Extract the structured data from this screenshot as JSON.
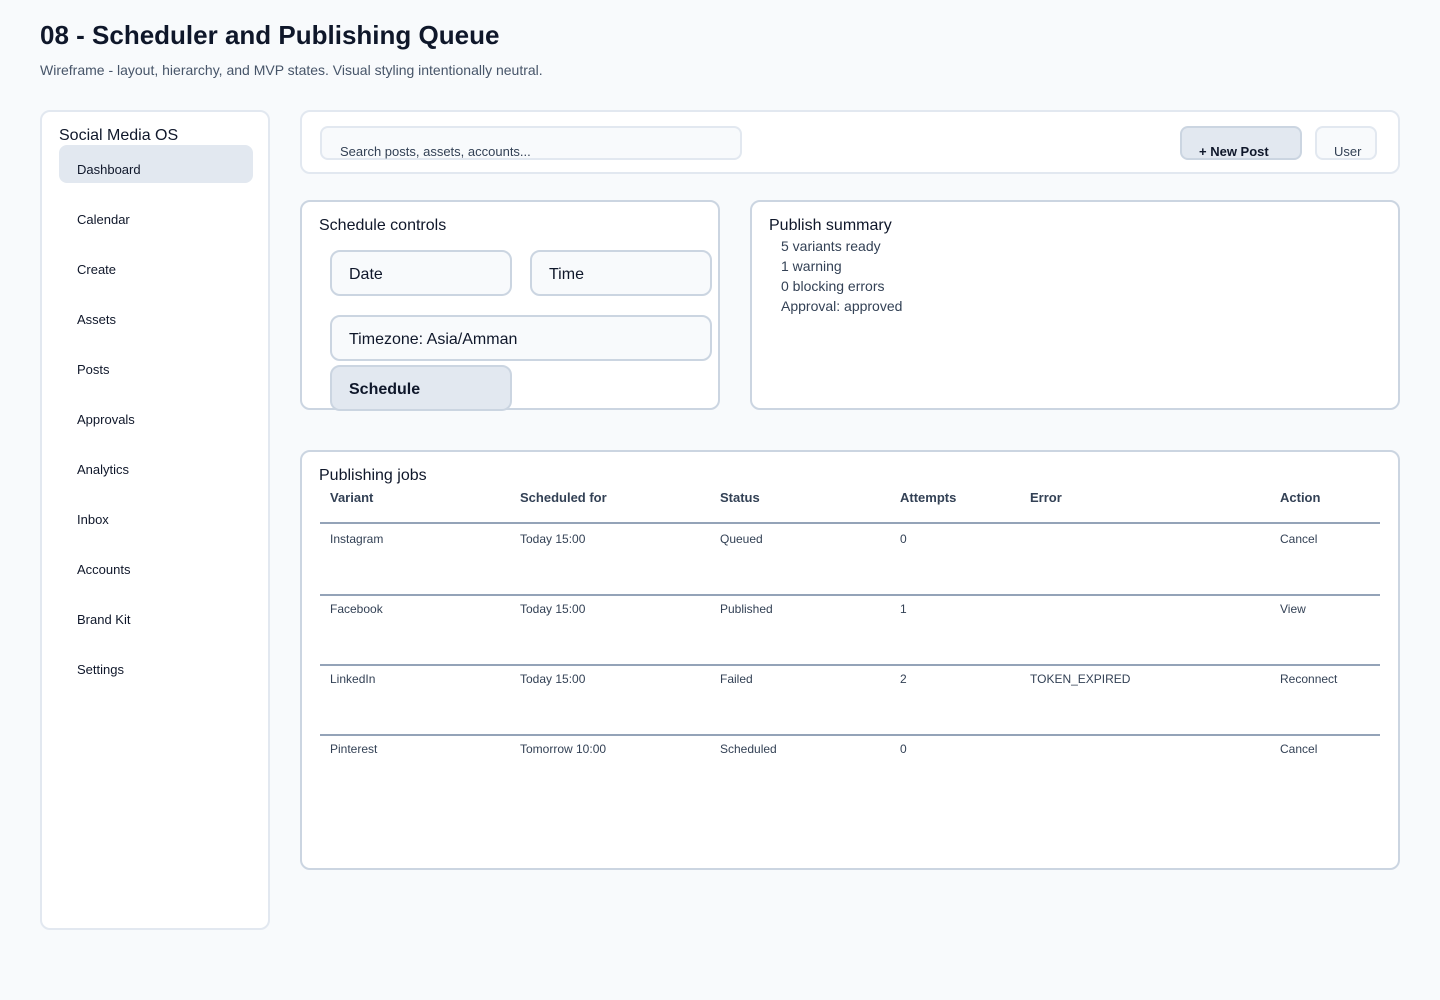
{
  "page": {
    "title": "08 - Scheduler and Publishing Queue",
    "subtitle": "Wireframe - layout, hierarchy, and MVP states. Visual styling intentionally neutral."
  },
  "sidebar": {
    "brand": "Social Media OS",
    "items": [
      {
        "label": "Dashboard",
        "active": true
      },
      {
        "label": "Calendar"
      },
      {
        "label": "Create"
      },
      {
        "label": "Assets"
      },
      {
        "label": "Posts"
      },
      {
        "label": "Approvals"
      },
      {
        "label": "Analytics"
      },
      {
        "label": "Inbox"
      },
      {
        "label": "Accounts"
      },
      {
        "label": "Brand Kit"
      },
      {
        "label": "Settings"
      }
    ]
  },
  "topbar": {
    "search_placeholder": "Search posts, assets, accounts...",
    "new_post_label": "+ New Post",
    "user_label": "User"
  },
  "controls": {
    "title": "Schedule controls",
    "date_label": "Date",
    "time_label": "Time",
    "timezone_label": "Timezone: Asia/Amman",
    "schedule_label": "Schedule"
  },
  "summary": {
    "title": "Publish summary",
    "lines": [
      "5 variants ready",
      "1 warning",
      "0 blocking errors",
      "Approval: approved"
    ]
  },
  "jobs": {
    "title": "Publishing jobs",
    "columns": [
      "Variant",
      "Scheduled for",
      "Status",
      "Attempts",
      "Error",
      "Action"
    ],
    "rows": [
      [
        "Instagram",
        "Today 15:00",
        "Queued",
        "0",
        "",
        "Cancel"
      ],
      [
        "Facebook",
        "Today 15:00",
        "Published",
        "1",
        "",
        "View"
      ],
      [
        "LinkedIn",
        "Today 15:00",
        "Failed",
        "2",
        "TOKEN_EXPIRED",
        "Reconnect"
      ],
      [
        "Pinterest",
        "Tomorrow 10:00",
        "Scheduled",
        "0",
        "",
        "Cancel"
      ]
    ]
  }
}
